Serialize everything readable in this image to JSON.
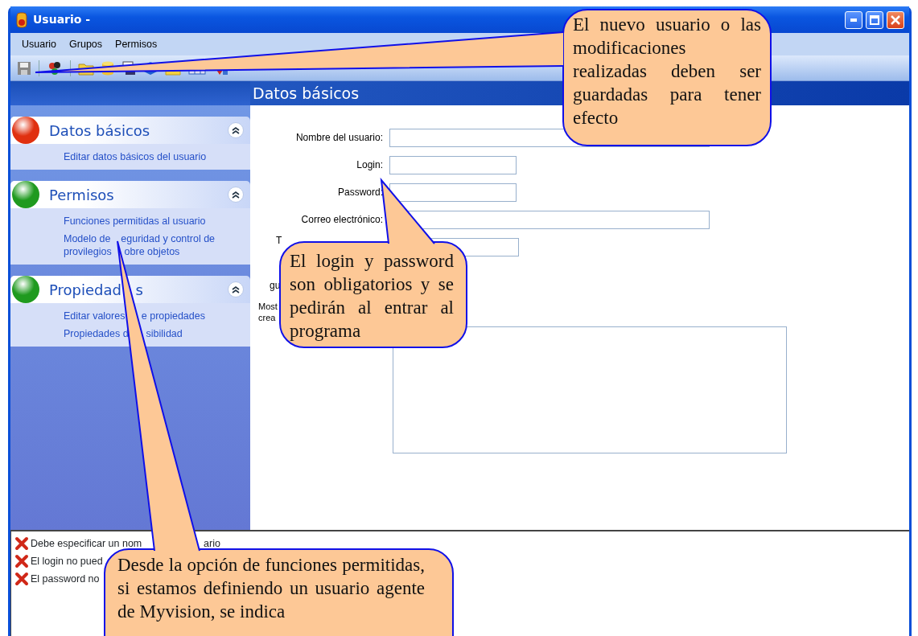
{
  "window": {
    "title": "Usuario -"
  },
  "menu": [
    "Usuario",
    "Grupos",
    "Permisos"
  ],
  "sidebar": {
    "sections": [
      {
        "title": "Datos básicos",
        "color": "#e03010",
        "expanded": true,
        "links": [
          [
            [
              "Editar datos básicos del usuario"
            ]
          ]
        ]
      },
      {
        "title": "Permisos",
        "color": "#1f9a1f",
        "expanded": true,
        "links": [
          [
            [
              "Funciones permitidas al usuario"
            ]
          ],
          [
            [
              "Modelo de",
              "eguridad y control de"
            ],
            [
              "provilegios",
              "obre objetos"
            ]
          ]
        ]
      },
      {
        "title": "Propiedad",
        "title_after": "s",
        "color": "#1f9a1f",
        "expanded": true,
        "links": [
          [
            [
              "Editar valores",
              "e propiedades"
            ]
          ],
          [
            [
              "Propiedades d",
              "sibilidad"
            ]
          ]
        ]
      }
    ]
  },
  "panel": {
    "title": "Datos básicos",
    "fields": [
      {
        "label": "Nombre del usuario:",
        "kind": "wide"
      },
      {
        "label": "Login:",
        "kind": "short"
      },
      {
        "label": "Password:",
        "kind": "short"
      },
      {
        "label": "Correo electrónico:",
        "kind": "wide"
      },
      {
        "label": "T",
        "kind": "cut"
      },
      {
        "label": "gu",
        "kind": "note"
      },
      {
        "label": "Most",
        "kind": "note2"
      },
      {
        "label": "crea",
        "kind": "note2"
      },
      {
        "kind": "area"
      }
    ]
  },
  "errors": [
    {
      "text": "Debe especificar un nom",
      "after": "ario"
    },
    {
      "text": "El login no pued"
    },
    {
      "text": "El password no"
    }
  ],
  "callouts": [
    {
      "text": "El nuevo usuario o las modificaciones realizadas deben ser guardadas para tener efecto"
    },
    {
      "text": "El login y password son obligatorios y se pedirán al entrar al programa"
    },
    {
      "text": "Desde la opción de funciones permitidas, si estamos definiendo un usuario agente de Myvision,  se indica"
    }
  ]
}
